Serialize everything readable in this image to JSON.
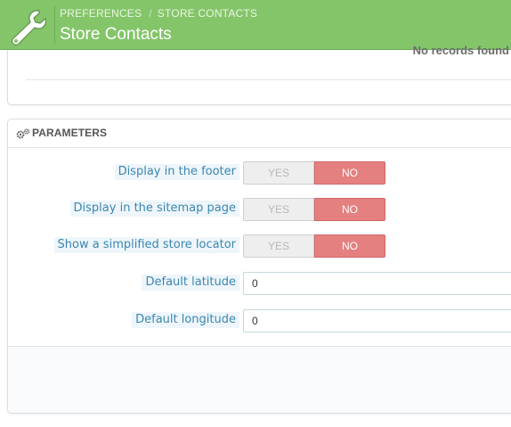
{
  "breadcrumb": {
    "parent": "PREFERENCES",
    "current": "STORE CONTACTS"
  },
  "page_title": "Store Contacts",
  "top_panel": {
    "no_records_text": "No records found"
  },
  "parameters": {
    "heading": "PARAMETERS",
    "switches": [
      {
        "label": "Display in the footer",
        "yes": "YES",
        "no": "NO",
        "selected": "NO"
      },
      {
        "label": "Display in the sitemap page",
        "yes": "YES",
        "no": "NO",
        "selected": "NO"
      },
      {
        "label": "Show a simplified store locator",
        "yes": "YES",
        "no": "NO",
        "selected": "NO"
      }
    ],
    "inputs": [
      {
        "label": "Default latitude",
        "value": "0"
      },
      {
        "label": "Default longitude",
        "value": "0"
      }
    ]
  },
  "colors": {
    "header_green": "#84c56a",
    "label_blue": "#3b86b1",
    "no_red": "#e58081"
  },
  "icons": {
    "header": "wrench-icon",
    "section": "cogs-icon"
  }
}
